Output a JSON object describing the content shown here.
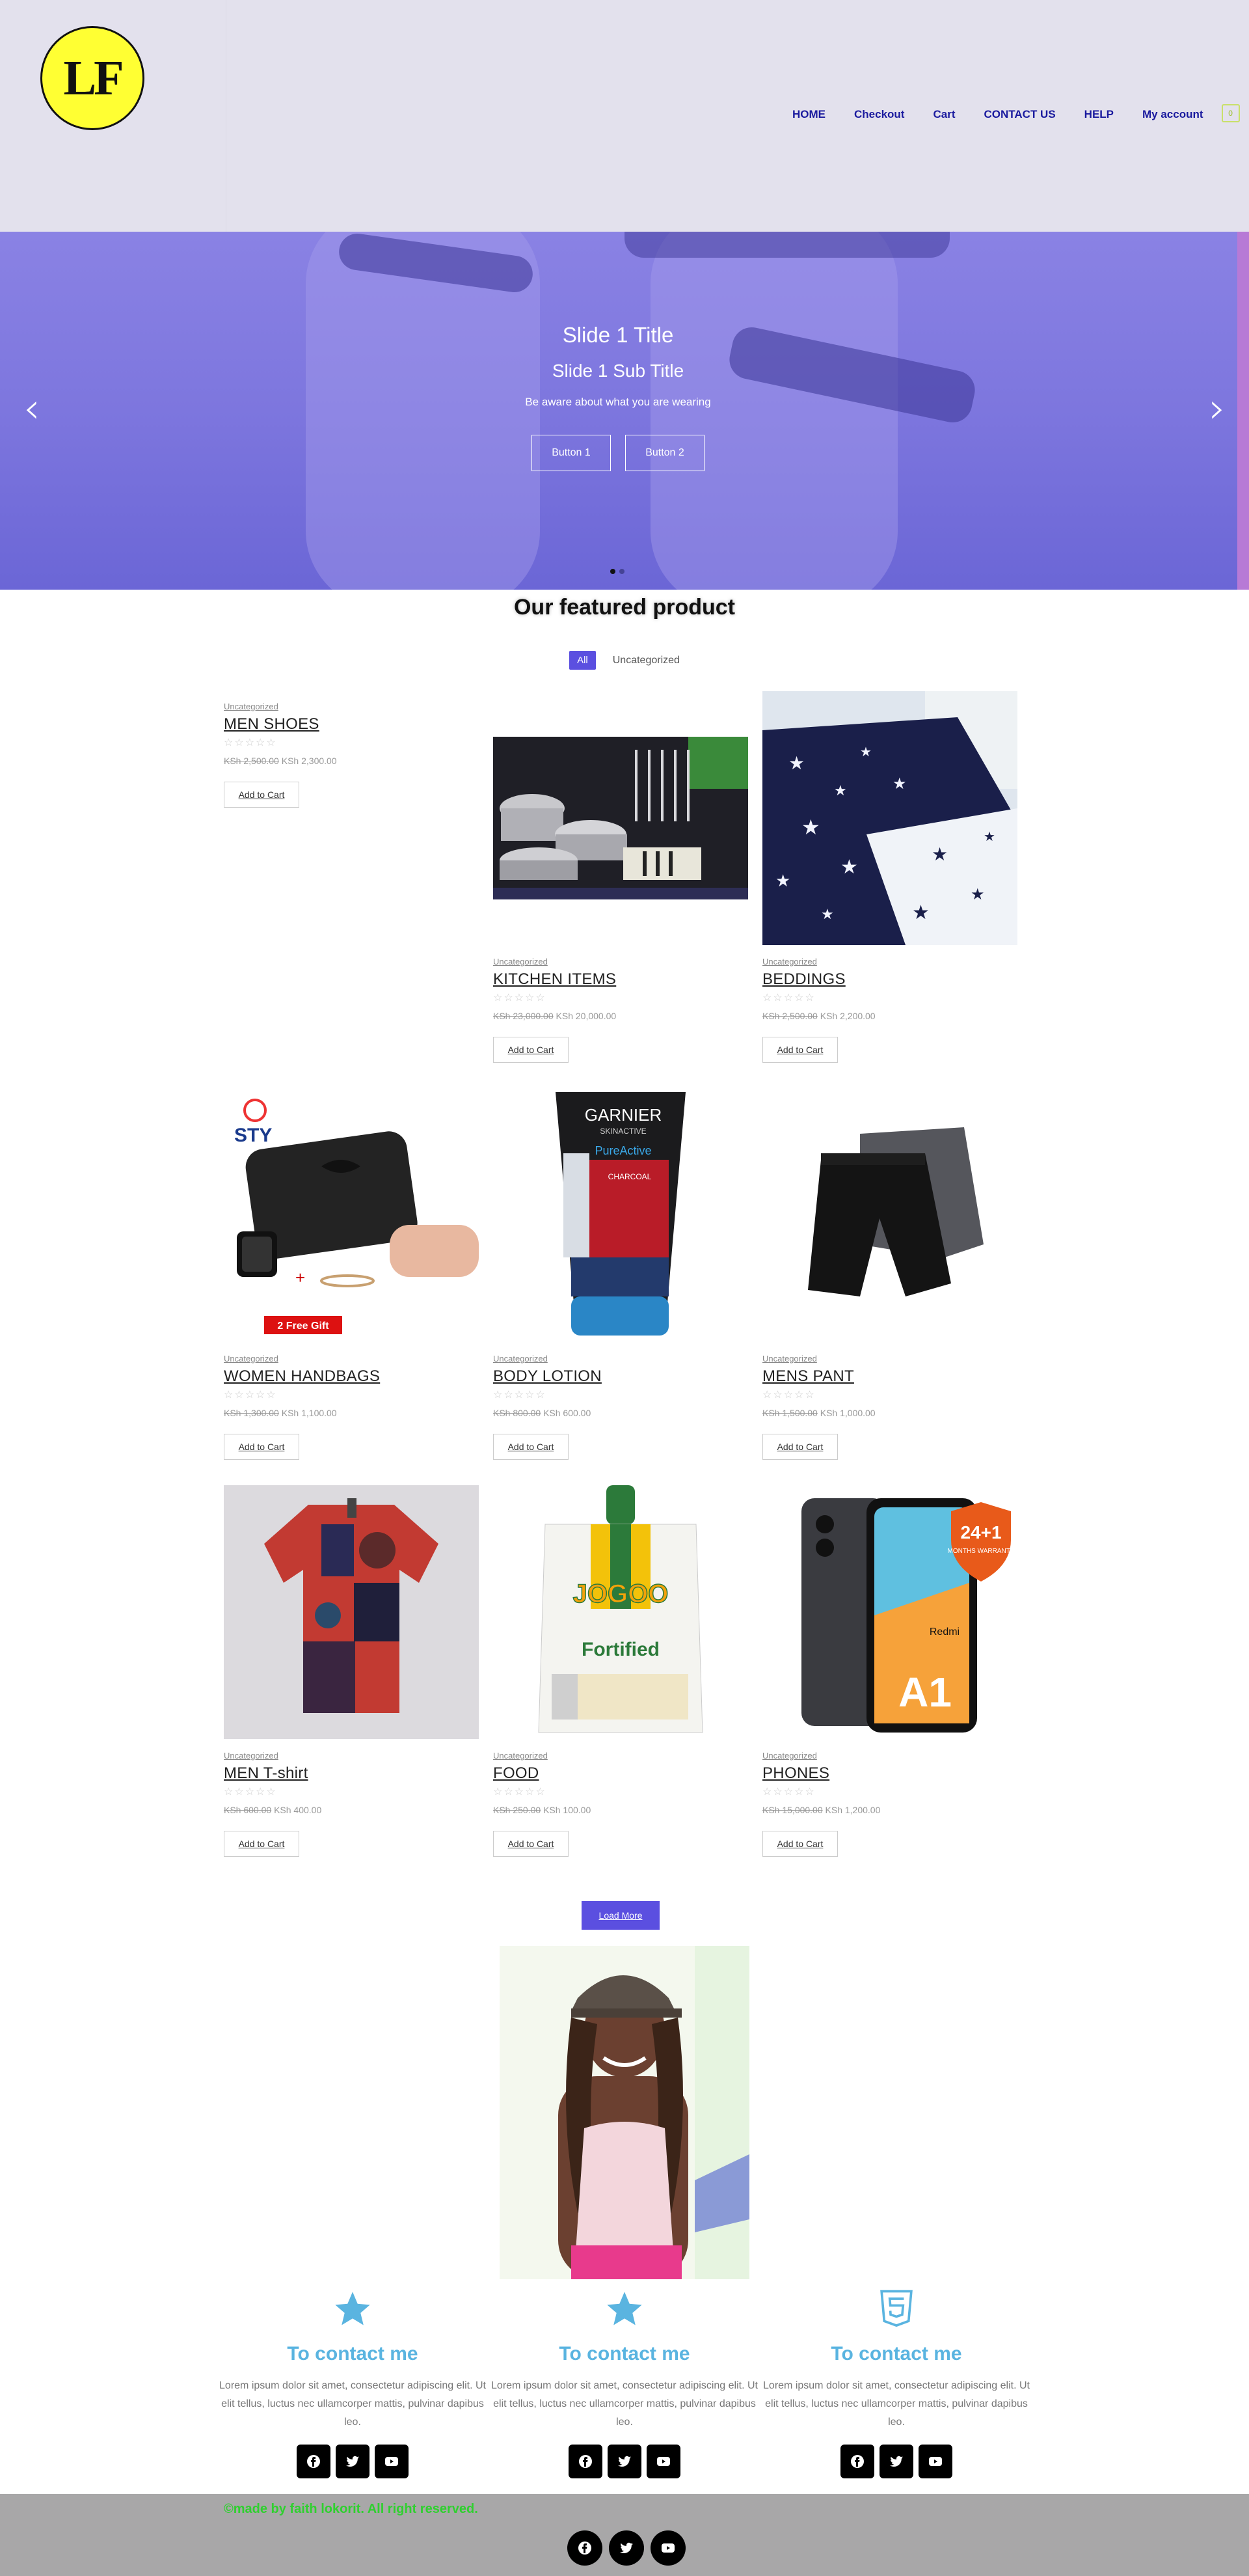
{
  "header": {
    "logo_text": "LF",
    "nav": [
      "HOME",
      "Checkout",
      "Cart",
      "CONTACT US",
      "HELP",
      "My account"
    ],
    "cart_count": "0"
  },
  "hero": {
    "title": "Slide 1 Title",
    "subtitle": "Slide 1 Sub Title",
    "text": "Be aware about what you are wearing",
    "button1": "Button 1",
    "button2": "Button 2",
    "slide_count": 2,
    "active_slide": 1
  },
  "featured": {
    "title": "Our featured product",
    "filters": [
      "All",
      "Uncategorized"
    ]
  },
  "products": [
    {
      "category": "Uncategorized",
      "name": "MEN SHOES",
      "old_price": "KSh 2,500.00",
      "price": "KSh 2,300.00",
      "button": "Add to Cart"
    },
    {
      "category": "Uncategorized",
      "name": "KITCHEN ITEMS",
      "old_price": "KSh 23,000.00",
      "price": "KSh 20,000.00",
      "button": "Add to Cart"
    },
    {
      "category": "Uncategorized",
      "name": "BEDDINGS",
      "old_price": "KSh 2,500.00",
      "price": "KSh 2,200.00",
      "button": "Add to Cart"
    },
    {
      "category": "Uncategorized",
      "name": "WOMEN HANDBAGS",
      "old_price": "KSh 1,300.00",
      "price": "KSh 1,100.00",
      "button": "Add to Cart"
    },
    {
      "category": "Uncategorized",
      "name": "BODY LOTION",
      "old_price": "KSh 800.00",
      "price": "KSh 600.00",
      "button": "Add to Cart"
    },
    {
      "category": "Uncategorized",
      "name": "MENS PANT",
      "old_price": "KSh 1,500.00",
      "price": "KSh 1,000.00",
      "button": "Add to Cart"
    },
    {
      "category": "Uncategorized",
      "name": "MEN T-shirt",
      "old_price": "KSh 600.00",
      "price": "KSh 400.00",
      "button": "Add to Cart"
    },
    {
      "category": "Uncategorized",
      "name": "FOOD",
      "old_price": "KSh 250.00",
      "price": "KSh 100.00",
      "button": "Add to Cart"
    },
    {
      "category": "Uncategorized",
      "name": "PHONES",
      "old_price": "KSh 15,000.00",
      "price": "KSh 1,200.00",
      "button": "Add to Cart"
    }
  ],
  "product_image_text": {
    "handbag_brand": "STY",
    "handbag_gift": "2 Free Gift",
    "lotion_brand": "GARNIER",
    "lotion_line": "SKINACTIVE",
    "lotion_product": "PureActive",
    "lotion_variant": "CHARCOAL",
    "food_brand": "JOGOO",
    "food_label": "Fortified",
    "phone_badge_big": "24+1",
    "phone_badge_small": "MONTHS WARRANTY",
    "phone_brand": "Redmi",
    "phone_model": "A1"
  },
  "stars_text": "☆☆☆☆☆",
  "load_more": "Load More",
  "contacts": [
    {
      "icon": "star-icon",
      "title": "To contact me",
      "text": "Lorem ipsum dolor sit amet, consectetur adipiscing elit. Ut elit tellus, luctus nec ullamcorper mattis, pulvinar dapibus leo."
    },
    {
      "icon": "star-icon",
      "title": "To contact me",
      "text": "Lorem ipsum dolor sit amet, consectetur adipiscing elit. Ut elit tellus, luctus nec ullamcorper mattis, pulvinar dapibus leo."
    },
    {
      "icon": "html5-icon",
      "title": "To contact me",
      "text": "Lorem ipsum dolor sit amet, consectetur adipiscing elit. Ut elit tellus, luctus nec ullamcorper mattis, pulvinar dapibus leo."
    }
  ],
  "footer": {
    "copyright": "©made by faith lokorit. All right reserved."
  },
  "colors": {
    "accent": "#5b4fe0",
    "nav_text": "#1a1a9e",
    "contact_title": "#5ab4e0",
    "footer_text": "#2fd02f"
  }
}
